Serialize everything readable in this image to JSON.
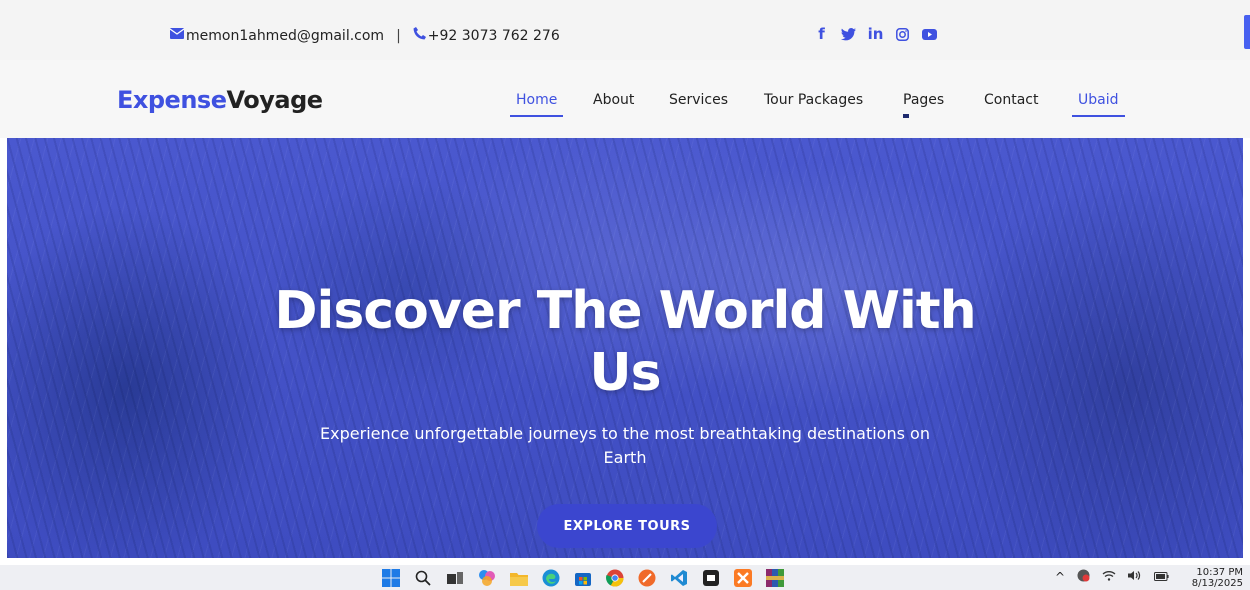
{
  "topbar": {
    "email": "memon1ahmed@gmail.com",
    "separator": "|",
    "phone": "+92 3073 762 276",
    "socials": [
      {
        "icon": "facebook-icon",
        "label": "f"
      },
      {
        "icon": "twitter-icon",
        "label": ""
      },
      {
        "icon": "linkedin-icon",
        "label": "in"
      },
      {
        "icon": "instagram-icon",
        "label": ""
      },
      {
        "icon": "youtube-icon",
        "label": ""
      }
    ]
  },
  "brand": {
    "part1": "Expense",
    "part2": "Voyage"
  },
  "nav": {
    "items": [
      {
        "label": "Home",
        "active": true
      },
      {
        "label": "About"
      },
      {
        "label": "Services"
      },
      {
        "label": "Tour Packages"
      },
      {
        "label": "Pages"
      },
      {
        "label": "Contact"
      },
      {
        "label": "Ubaid"
      }
    ]
  },
  "hero": {
    "title_line1": "Discover The World With",
    "title_line2": "Us",
    "subtitle_line1": "Experience unforgettable journeys to the most breathtaking destinations on",
    "subtitle_line2": "Earth",
    "button": "EXPLORE TOURS"
  },
  "taskbar": {
    "time": "10:37 PM",
    "date": "8/13/2025",
    "tray_chevron": "^"
  },
  "colors": {
    "accent": "#3f51e0",
    "hero_overlay": "#4553c8",
    "button": "#3b46cf"
  }
}
